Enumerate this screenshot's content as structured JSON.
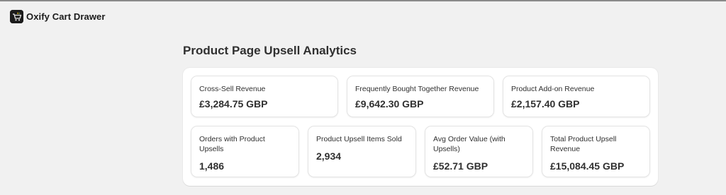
{
  "app": {
    "title": "Oxify Cart Drawer",
    "logo_icon": "cart-logo-icon"
  },
  "page": {
    "title": "Product Page Upsell Analytics"
  },
  "metrics": [
    {
      "label": "Cross-Sell Revenue",
      "value": "£3,284.75 GBP"
    },
    {
      "label": "Frequently Bought Together Revenue",
      "value": "£9,642.30 GBP"
    },
    {
      "label": "Product Add-on Revenue",
      "value": "£2,157.40 GBP"
    },
    {
      "label": "Orders with Product Upsells",
      "value": "1,486"
    },
    {
      "label": "Product Upsell Items Sold",
      "value": "2,934"
    },
    {
      "label": "Avg Order Value (with Upsells)",
      "value": "£52.71 GBP"
    },
    {
      "label": "Total Product Upsell Revenue",
      "value": "£15,084.45 GBP"
    }
  ],
  "colors": {
    "background": "#f1f1f1",
    "surface": "#ffffff",
    "text": "#303030"
  }
}
